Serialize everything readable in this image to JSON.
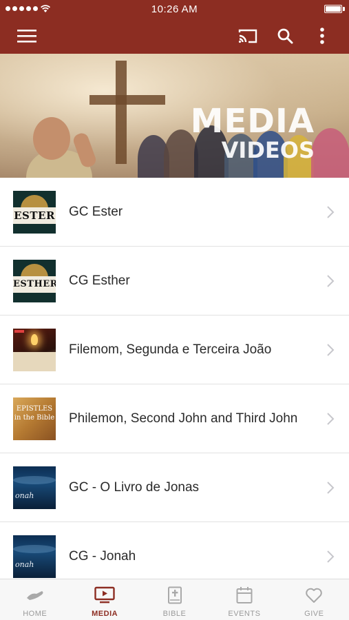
{
  "status_bar": {
    "time": "10:26 AM"
  },
  "app_bar": {
    "icons": [
      "menu-icon",
      "cast-icon",
      "search-icon",
      "more-vert-icon"
    ]
  },
  "hero": {
    "line1": "MEDIA",
    "line2": "VIDEOS"
  },
  "media_items": [
    {
      "title": "GC Ester",
      "thumb_text": "ESTER"
    },
    {
      "title": "CG Esther",
      "thumb_text": "ESTHER"
    },
    {
      "title": "Filemom, Segunda e Terceira João"
    },
    {
      "title": "Philemon, Second John and Third John",
      "thumb_text": "EPISTLES in the Bible"
    },
    {
      "title": "GC - O Livro de Jonas",
      "thumb_text": "onah"
    },
    {
      "title": "CG - Jonah",
      "thumb_text": "onah"
    }
  ],
  "tabs": [
    {
      "label": "HOME",
      "icon": "home-hands-icon",
      "active": false
    },
    {
      "label": "MEDIA",
      "icon": "play-tv-icon",
      "active": true
    },
    {
      "label": "BIBLE",
      "icon": "bible-icon",
      "active": false
    },
    {
      "label": "EVENTS",
      "icon": "calendar-icon",
      "active": false
    },
    {
      "label": "GIVE",
      "icon": "heart-icon",
      "active": false
    }
  ],
  "colors": {
    "brand": "#8c2d22",
    "tab_inactive": "#9a9a9a",
    "divider": "#e2e2e2"
  }
}
